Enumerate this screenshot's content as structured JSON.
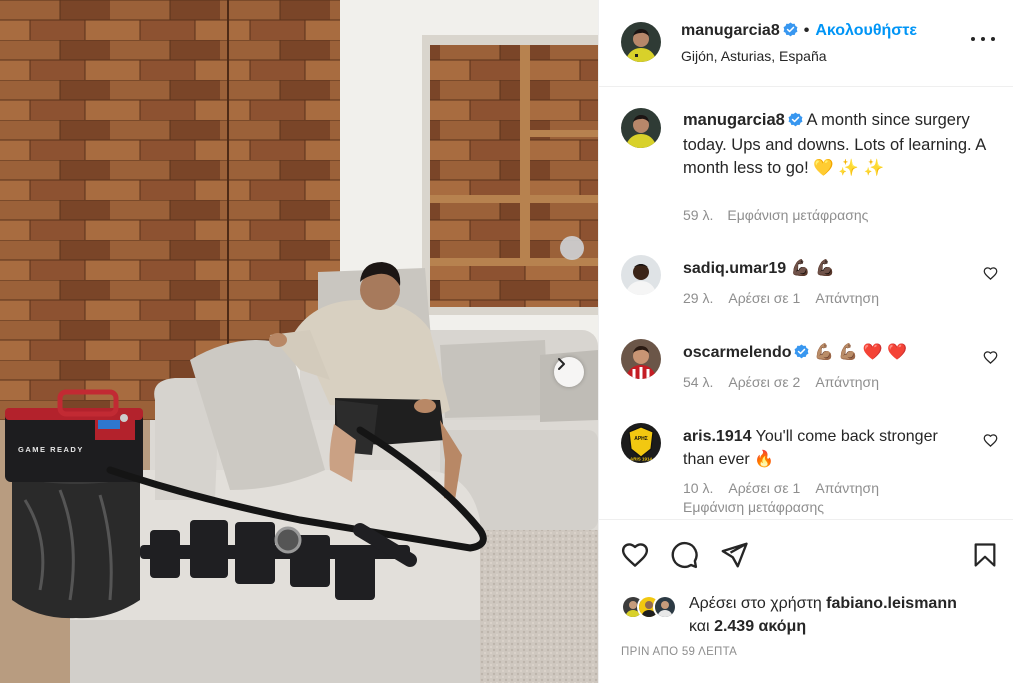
{
  "photo": {
    "device_label": "GAME READY",
    "next_button": "chevron-right-icon"
  },
  "header": {
    "username": "manugarcia8",
    "separator": "•",
    "follow_label": "Ακολουθήστε",
    "location": "Gijón, Asturias, España",
    "more_icon": "more-horizontal-icon"
  },
  "caption": {
    "username": "manugarcia8",
    "text": "A month since surgery today. Ups and downs. Lots of learning. A month less to go! 💛 ✨ ✨",
    "time": "59 λ.",
    "translate_label": "Εμφάνιση μετάφρασης"
  },
  "comments": [
    {
      "username": "sadiq.umar19",
      "text": "💪🏿 💪🏿",
      "time": "29 λ.",
      "likes": "Αρέσει σε 1",
      "reply": "Απάντηση",
      "verified": false
    },
    {
      "username": "oscarmelendo",
      "text": "💪🏽 💪🏽 ❤️ ❤️",
      "time": "54 λ.",
      "likes": "Αρέσει σε 2",
      "reply": "Απάντηση",
      "verified": true
    },
    {
      "username": "aris.1914",
      "text": "You'll come back stronger than ever 🔥",
      "time": "10 λ.",
      "likes": "Αρέσει σε 1",
      "reply": "Απάντηση",
      "translate": "Εμφάνιση μετάφρασης",
      "verified": false
    }
  ],
  "aris_badge": {
    "line1": "ΑΡΗΣ",
    "line2": "ARIS 1914"
  },
  "actions": {
    "icons": [
      "heart-icon",
      "comment-icon",
      "share-icon",
      "bookmark-icon"
    ],
    "liked_by_prefix": "Αρέσει στο χρήστη",
    "liked_by_user": "fabiano.leismann",
    "and_label": "και",
    "others_count": "2.439 ακόμη",
    "posted_ago": "ΠΡΙΝ ΑΠΟ 59 ΛΕΠΤΑ"
  },
  "colors": {
    "accent": "#0095f6",
    "text": "#262626",
    "muted": "#8e8e8e",
    "divider": "#efefef",
    "verified": "#3897f0"
  }
}
